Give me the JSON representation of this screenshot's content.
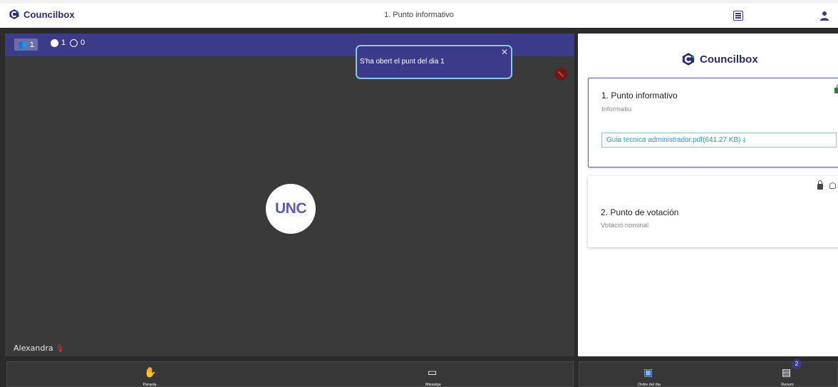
{
  "header": {
    "brand": "Councilbox",
    "title": "1. Punto informativo",
    "list_icon": "list-icon",
    "user_icon": "user-icon"
  },
  "video": {
    "stats": [
      {
        "icon": "users-icon",
        "value": "1"
      },
      {
        "icon": "globe-icon",
        "value": "1"
      },
      {
        "icon": "smile-icon",
        "value": "0"
      }
    ],
    "notification": "S'ha obert el punt del dia 1",
    "avatar_text": "UNC",
    "participant_name": "Alexandra"
  },
  "panel": {
    "brand": "Councilbox",
    "agenda": [
      {
        "title": "1. Punto informativo",
        "type": "Informatiu",
        "attachment": "Guia tecnica administrador.pdf(641.27 KB)",
        "status": "open"
      },
      {
        "title": "2. Punto de votación",
        "type": "Votació nominal",
        "status": "closed"
      }
    ]
  },
  "bottom": {
    "buttons": [
      {
        "label": "Paraula",
        "icon": "hand-icon"
      },
      {
        "label": "Missatge",
        "icon": "message-icon"
      },
      {
        "label": "Ordre del dia",
        "icon": "calendar-icon"
      },
      {
        "label": "Resum",
        "icon": "document-icon",
        "badge": "2"
      }
    ]
  },
  "colors": {
    "brand": "#2a2a6e",
    "accent": "#3b3b8a",
    "link": "#2a9bbf",
    "muted": "#e53935"
  }
}
